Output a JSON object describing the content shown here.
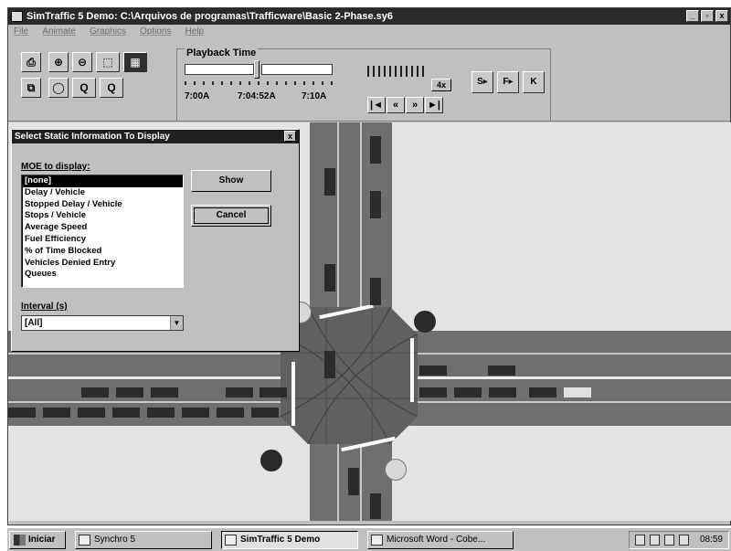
{
  "window": {
    "title": "SimTraffic 5 Demo: C:\\Arquivos de programas\\Trafficware\\Basic 2-Phase.sy6",
    "controls": {
      "minimize": "_",
      "maximize": "▫",
      "close": "x"
    }
  },
  "menu": [
    "File",
    "Animate",
    "Graphics",
    "Options",
    "Help"
  ],
  "toolbar": {
    "buttons": [
      "print-icon",
      "copy-icon",
      "zoom-in-icon",
      "zoom-out-icon",
      "zoom-window-icon",
      "map-view-icon",
      "zoom-all-icon",
      "zoom-previous-icon",
      "zoom-scale-icon"
    ],
    "playback": {
      "label": "Playback Time",
      "start_time": "7:00A",
      "current_time": "7:04:52A",
      "end_time": "7:10A",
      "position": 0.49,
      "speed": "4x",
      "controls": [
        "|◄",
        "«",
        "»",
        "►|"
      ],
      "side_buttons": [
        "S▸",
        "F▸",
        "K"
      ]
    }
  },
  "dialog": {
    "title": "Select Static Information To Display",
    "moe_label": "MOE to display:",
    "moe_options": [
      "[none]",
      "Delay / Vehicle",
      "Stopped Delay / Vehicle",
      "Stops / Vehicle",
      "Average Speed",
      "Fuel Efficiency",
      "% of Time Blocked",
      "Vehicles Denied Entry",
      "Queues"
    ],
    "selected_index": 0,
    "interval_label": "Interval (s)",
    "interval_value": "[All]",
    "show_button": "Show",
    "cancel_button": "Cancel",
    "close": "x"
  },
  "taskbar": {
    "start": "Iniciar",
    "tasks": [
      "Synchro 5",
      "SimTraffic 5 Demo",
      "Microsoft Word - Cobe..."
    ],
    "active_task": 1,
    "clock": "08:59"
  }
}
